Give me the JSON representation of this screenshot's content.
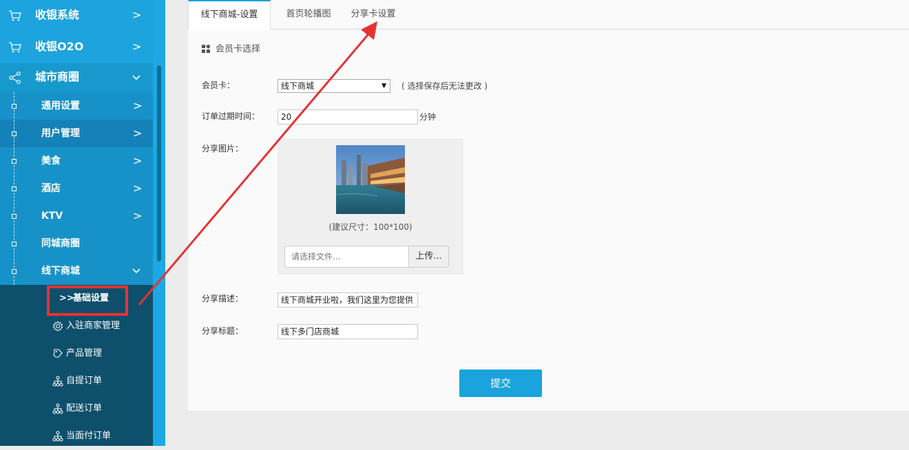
{
  "sidebar": {
    "top_items": [
      {
        "label": "收银系统",
        "chevron": ">"
      },
      {
        "label": "收银O2O",
        "chevron": ">"
      },
      {
        "label": "城市商圈",
        "chevron": "⌄"
      }
    ],
    "sub_items": [
      {
        "label": "通用设置",
        "chevron": ">"
      },
      {
        "label": "用户管理",
        "chevron": ">"
      },
      {
        "label": "美食",
        "chevron": ">"
      },
      {
        "label": "酒店",
        "chevron": ">"
      },
      {
        "label": "KTV",
        "chevron": ">"
      },
      {
        "label": "同城商圈",
        "chevron": ""
      },
      {
        "label": "线下商城",
        "chevron": "⌄"
      }
    ],
    "leaf_items": [
      {
        "label": "基础设置",
        "icon": "double-chevron-icon",
        "glyph": ">>"
      },
      {
        "label": "入驻商家管理",
        "icon": "gear-icon"
      },
      {
        "label": "产品管理",
        "icon": "tag-icon"
      },
      {
        "label": "自提订单",
        "icon": "org-tree-icon"
      },
      {
        "label": "配送订单",
        "icon": "org-tree-icon"
      },
      {
        "label": "当面付订单",
        "icon": "org-tree-icon"
      }
    ],
    "active_leaf": "基础设置"
  },
  "tabs": [
    {
      "label": "线下商城-设置",
      "active": true
    },
    {
      "label": "首页轮播图",
      "active": false
    },
    {
      "label": "分享卡设置",
      "active": false
    }
  ],
  "section": {
    "title": "会员卡选择",
    "icon": "grid-icon"
  },
  "form": {
    "member_card": {
      "label": "会员卡：",
      "value": "线下商城",
      "note": "( 选择保存后无法更改 )"
    },
    "order_expire": {
      "label": "订单过期时间：",
      "value": "20",
      "unit": "分钟"
    },
    "share_image": {
      "label": "分享图片：",
      "hint": "(建议尺寸：100*100)",
      "file_placeholder": "请选择文件...",
      "upload_label": "上传..."
    },
    "share_desc": {
      "label": "分享描述：",
      "value": "线下商城开业啦，我们这里为您提供"
    },
    "share_title": {
      "label": "分享标题：",
      "value": "线下多门店商城"
    },
    "submit_label": "提交"
  },
  "colors": {
    "sidebar_blue": "#18a1db",
    "leaf_dark": "#0e4f6c",
    "accent": "#1aa3dd",
    "annotation_red": "#e53333"
  }
}
